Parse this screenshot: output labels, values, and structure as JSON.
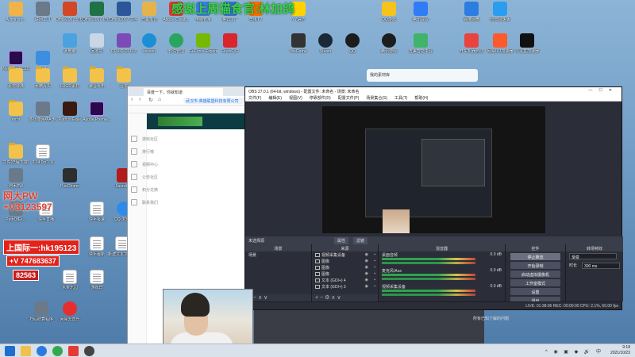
{
  "overlay": {
    "stream_title": "感谢上周猫食官:林加鸽",
    "watermark_1": "网大PW",
    "watermark_2": "+V3123597",
    "banner_1": "上国际一:hk195123",
    "banner_2": "+V 747683637",
    "banner_3": "82563"
  },
  "desktop_icons": [
    {
      "label": "Administr...",
      "kind": "user"
    },
    {
      "label": "Premiere CC2019",
      "kind": "pr"
    },
    {
      "label": "素材转换",
      "kind": "folder"
    },
    {
      "label": "error",
      "kind": "folder"
    },
    {
      "label": "文件(已解下载)",
      "kind": "folder"
    },
    {
      "label": "阿木PW",
      "kind": "app"
    },
    {
      "label": "PathOfEx...",
      "kind": "app"
    },
    {
      "label": "联网工具",
      "kind": "app"
    },
    {
      "label": "网络",
      "kind": "net"
    },
    {
      "label": "水精片头",
      "kind": "folder"
    },
    {
      "label": "多功能网络AHK",
      "kind": "app"
    },
    {
      "label": "2.14.0c(1.1)",
      "kind": "sheet"
    },
    {
      "label": "Office2007 幻灯片PPT",
      "kind": "ppt"
    },
    {
      "label": "此电脑",
      "kind": "pc"
    },
    {
      "label": "LOGO素材",
      "kind": "folder"
    },
    {
      "label": "Path of Exile",
      "kind": "poe"
    },
    {
      "label": "Office2007 记灯库",
      "kind": "excel"
    },
    {
      "label": "回收站",
      "kind": "bin"
    },
    {
      "label": "聚合专用",
      "kind": "folder"
    },
    {
      "label": "Adobe Premie...",
      "kind": "pr"
    },
    {
      "label": "Office2007 文字",
      "kind": "word"
    },
    {
      "label": "CPUID CPU-Z",
      "kind": "cpuz"
    },
    {
      "label": "台本",
      "kind": "folder"
    },
    {
      "label": "Launcher",
      "kind": "launcher"
    },
    {
      "label": "PoeCharm",
      "kind": "poecharm"
    },
    {
      "label": "快手极速",
      "kind": "sheet"
    },
    {
      "label": "QQ 浏览器",
      "kind": "qqb"
    },
    {
      "label": "已备笔记",
      "kind": "note"
    },
    {
      "label": "version",
      "kind": "edge"
    },
    {
      "label": "Adobe Creati...",
      "kind": "adobe"
    },
    {
      "label": "软件管理",
      "kind": "pin"
    },
    {
      "label": "电脑管家",
      "kind": "shield"
    },
    {
      "label": "GeForce Experience",
      "kind": "nv"
    },
    {
      "label": "格式工厂",
      "kind": "ff"
    },
    {
      "label": "FlashFXP",
      "kind": "fxp"
    },
    {
      "label": "芒果TV",
      "kind": "mgtv"
    },
    {
      "label": "YY语音",
      "kind": "yy"
    },
    {
      "label": "WeGame",
      "kind": "wegame"
    },
    {
      "label": "Steam",
      "kind": "steam"
    },
    {
      "label": "QQ",
      "kind": "qq"
    },
    {
      "label": "QQ游戏",
      "kind": "qqgame"
    },
    {
      "label": "腾讯游戏",
      "kind": "qq"
    },
    {
      "label": "腾讯会议",
      "kind": "meet"
    },
    {
      "label": "五美智能平台",
      "kind": "green"
    },
    {
      "label": "百度网盘",
      "kind": "baidu"
    },
    {
      "label": "迅雷极速版",
      "kind": "xunlei"
    },
    {
      "label": "开车机器启动",
      "kind": "remote"
    },
    {
      "label": "网易UU加速器",
      "kind": "uu"
    },
    {
      "label": "小黑盒加速器",
      "kind": "box"
    },
    {
      "label": "快手直播",
      "kind": "sheet"
    },
    {
      "label": "快手最新",
      "kind": "sheet"
    },
    {
      "label": "新建文本文档(2)",
      "kind": "sheet"
    },
    {
      "label": "水果乐园",
      "kind": "sheet"
    },
    {
      "label": "游戏日",
      "kind": "sheet"
    },
    {
      "label": "扫码结算程序",
      "kind": "app"
    },
    {
      "label": "网易云音乐",
      "kind": "netease"
    }
  ],
  "browser": {
    "tab_label": "百度一下，你就知道",
    "url": "武汉市-英雄联盟科技有限公司",
    "menu": [
      "游戏社区",
      "排行榜",
      "视频中心",
      "公告社区",
      "积分兑换",
      "联系我们"
    ]
  },
  "obs": {
    "title": "OBS 27.0.1 (64-bit, windows) - 配置文件: 未命名 - 场景: 未命名",
    "menu": [
      "文件(F)",
      "编辑(E)",
      "视图(V)",
      "停靠部件(D)",
      "配置文件(P)",
      "场景集合(S)",
      "工具(T)",
      "帮助(H)"
    ],
    "source_bar": "未选择源",
    "source_bar_buttons": [
      "属性",
      "滤镜"
    ],
    "scenes_header": "场景",
    "scenes": [
      "场景"
    ],
    "sources_header": "来源",
    "sources": [
      {
        "name": "视频采集设备"
      },
      {
        "name": "图像"
      },
      {
        "name": "图像"
      },
      {
        "name": "图像"
      },
      {
        "name": "文本 (GDI+) 4"
      },
      {
        "name": "文本 (GDI+) 3"
      }
    ],
    "mixer_header": "混音器",
    "mixer": [
      {
        "name": "桌面音频",
        "db": "0.0 dB"
      },
      {
        "name": "麦克风/Aux",
        "db": "0.0 dB"
      },
      {
        "name": "视频采集设备",
        "db": "0.0 dB"
      }
    ],
    "controls_header": "控件",
    "controls": [
      "停止推流",
      "开始录制",
      "启动虚拟摄像机",
      "工作室模式",
      "设置",
      "退出"
    ],
    "transitions_header": "转场特效",
    "transition_type": "渐变",
    "duration_label": "时长",
    "duration_value": "300 ms",
    "status": "LIVE: 01:38:06   REC: 00:00:00   CPU: 2.1%, 60.00 fps"
  },
  "taskbar": {
    "time": "9:18",
    "date": "2021/10/23",
    "lang": "中"
  },
  "mini_bar": "我的素材库",
  "strip_text": "所有已知了解的问题"
}
